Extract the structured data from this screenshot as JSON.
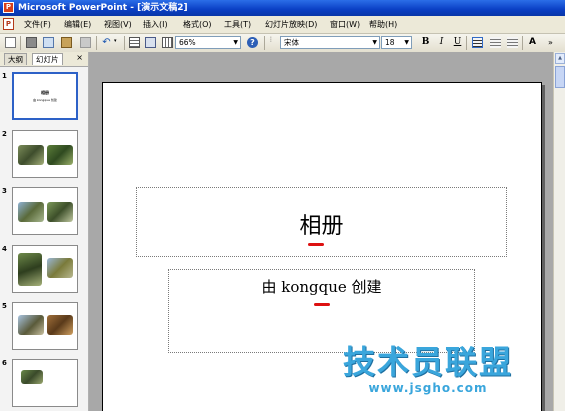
{
  "window": {
    "title": "Microsoft PowerPoint - [演示文稿2]"
  },
  "menubar": {
    "items": [
      "文件(F)",
      "编辑(E)",
      "视图(V)",
      "插入(I)",
      "格式(O)",
      "工具(T)",
      "幻灯片放映(D)",
      "窗口(W)",
      "帮助(H)"
    ]
  },
  "toolbar": {
    "zoom": "66%",
    "font": "宋体",
    "font_size": "18",
    "bold": "B",
    "italic": "I",
    "underline": "U"
  },
  "panel": {
    "tabs": [
      "大纲",
      "幻灯片"
    ],
    "close": "×",
    "slide_numbers": [
      "1",
      "2",
      "3",
      "4",
      "5",
      "6"
    ]
  },
  "thumb1": {
    "title": "相册",
    "subtitle": "由 kongque 创建"
  },
  "slide": {
    "title": "相册",
    "subtitle": "由 kongque 创建"
  },
  "watermark": {
    "main": "技术员联盟",
    "url": "www.jsgho.com"
  },
  "colors": {
    "titlebar": "#0a3fc4",
    "accent_red": "#dd1111",
    "watermark": "#3aa6dc"
  },
  "icons": [
    "powerpoint-icon",
    "new-icon",
    "print-icon",
    "copy-icon",
    "paste-icon",
    "format-painter-icon",
    "undo-icon",
    "table-icon",
    "chart-icon",
    "help-icon"
  ]
}
